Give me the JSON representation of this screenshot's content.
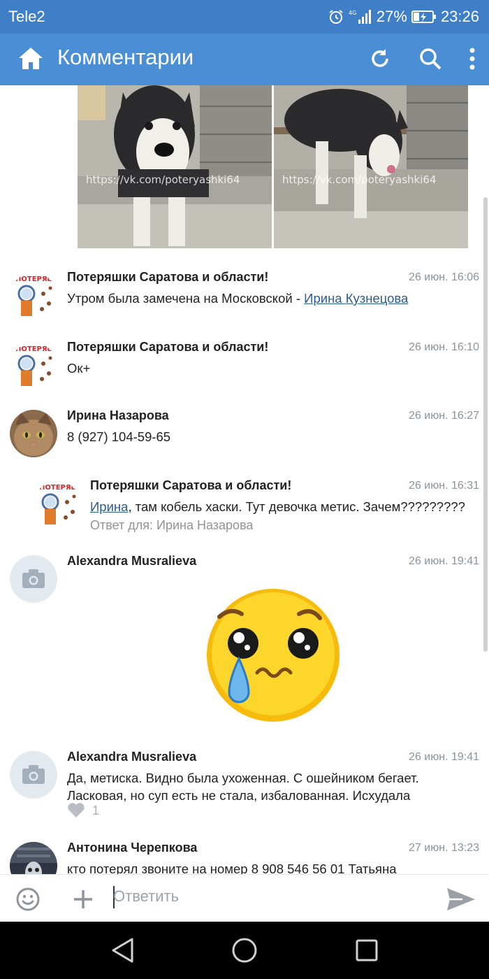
{
  "status": {
    "carrier": "Tele2",
    "battery": "27%",
    "time": "23:26",
    "network": "4G"
  },
  "appbar": {
    "title": "Комментарии"
  },
  "photos": {
    "watermark": "https://vk.com/poteryashki64"
  },
  "comments": [
    {
      "author": "Потеряшки Саратова и области!",
      "time": "26 июн. 16:06",
      "text": "Утром была замечена на Московской - ",
      "mention": "Ирина Кузнецова"
    },
    {
      "author": "Потеряшки Саратова и области!",
      "time": "26 июн. 16:10",
      "text": "Ок+"
    },
    {
      "author": "Ирина Назарова",
      "time": "26 июн. 16:27",
      "text": "8 (927) 104-59-65"
    },
    {
      "author": "Потеряшки Саратова и области!",
      "time": "26 июн. 16:31",
      "mention": "Ирина",
      "text": ", там кобель хаски. Тут девочка метис. Зачем?????????",
      "reply_to": "Ответ для: Ирина Назарова"
    },
    {
      "author": "Alexandra Musralieva",
      "time": "26 июн. 19:41"
    },
    {
      "author": "Alexandra Musralieva",
      "time": "26 июн. 19:41",
      "text": "Да, метиска. Видно была ухоженная. С ошейником бегает. Ласковая, но суп есть не стала, избалованная. Исхудала",
      "likes": "1"
    },
    {
      "author": "Антонина Черепкова",
      "time": "27 июн. 13:23",
      "text": "кто потерял звоните на номер 8 908 546 56 01 Татьяна"
    }
  ],
  "composer": {
    "placeholder": "Ответить"
  },
  "colors": {
    "appbar": "#4a8fd6",
    "statusbar": "#3f7fc7",
    "link": "#2a5d8f",
    "timestamp": "#8d9299"
  }
}
